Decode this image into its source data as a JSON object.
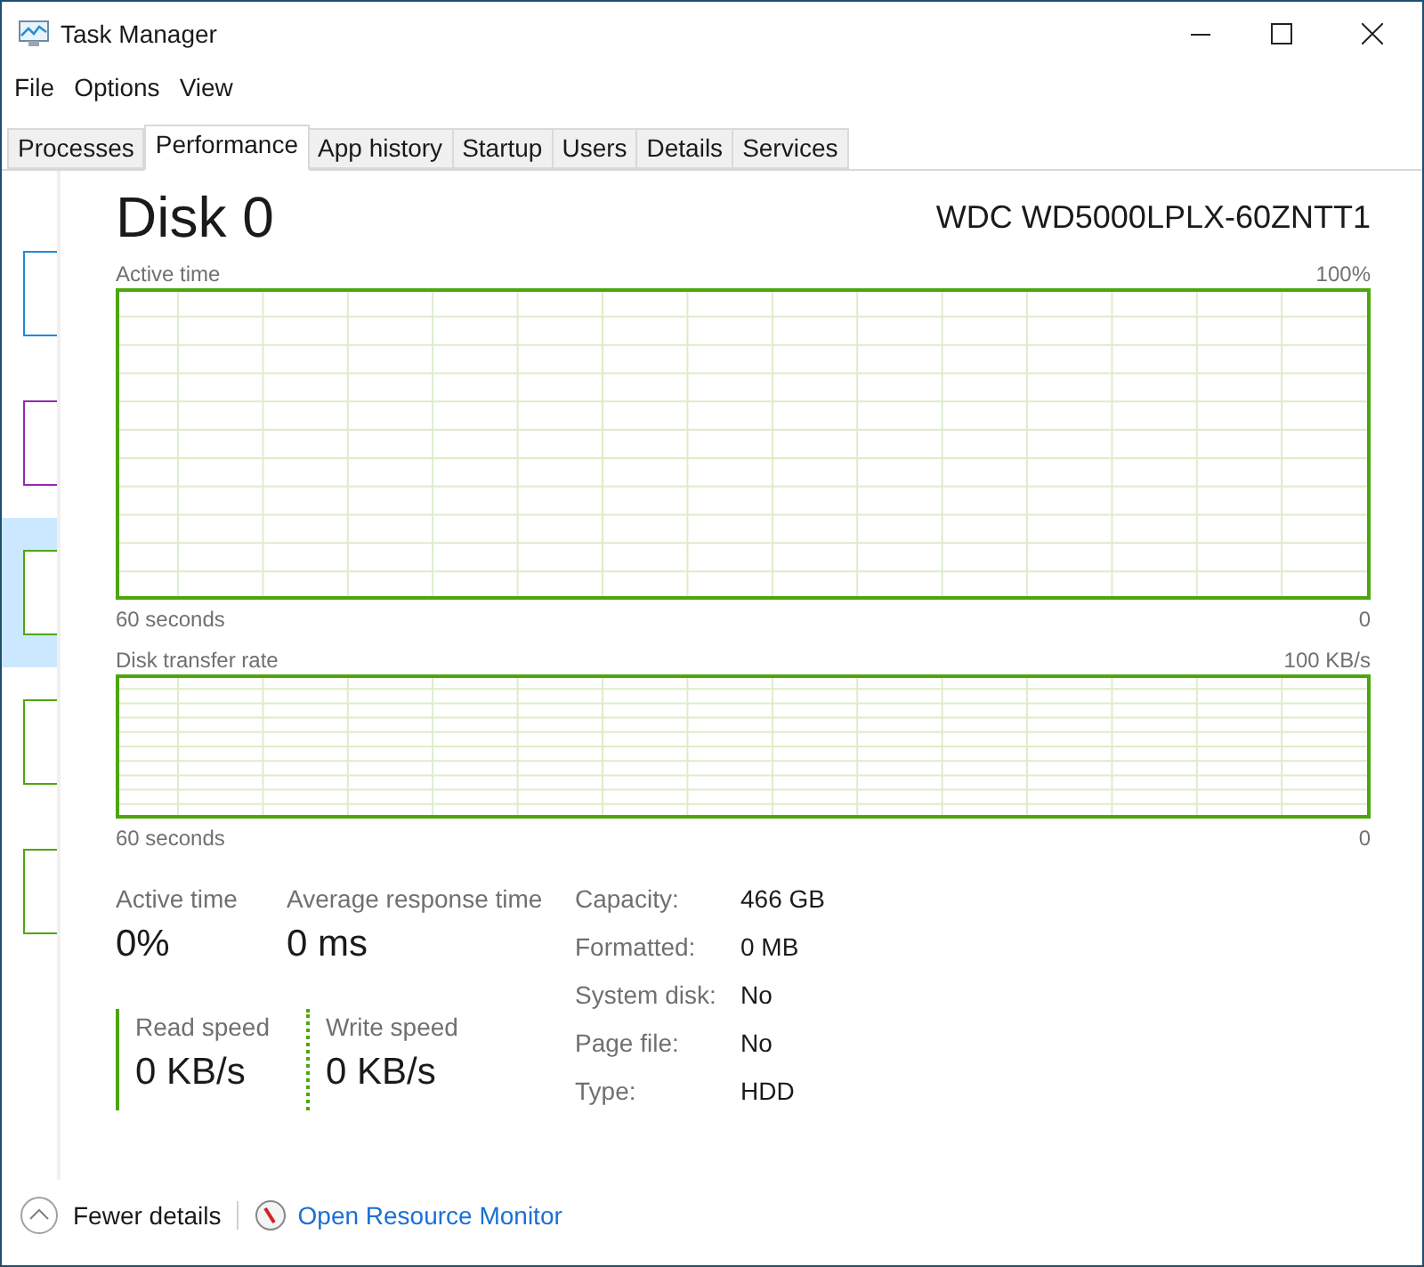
{
  "window": {
    "title": "Task Manager"
  },
  "menu": [
    "File",
    "Options",
    "View"
  ],
  "tabs": [
    {
      "label": "Processes",
      "selected": false
    },
    {
      "label": "Performance",
      "selected": true
    },
    {
      "label": "App history",
      "selected": false
    },
    {
      "label": "Startup",
      "selected": false
    },
    {
      "label": "Users",
      "selected": false
    },
    {
      "label": "Details",
      "selected": false
    },
    {
      "label": "Services",
      "selected": false
    }
  ],
  "sidebar": {
    "items": [
      {
        "color": "#1c8adb",
        "selected": false
      },
      {
        "color": "#9528b4",
        "selected": false
      },
      {
        "color": "#4da60c",
        "selected": true
      },
      {
        "color": "#4da60c",
        "selected": false
      },
      {
        "color": "#4da60c",
        "selected": false
      }
    ]
  },
  "header": {
    "title": "Disk 0",
    "model": "WDC WD5000LPLX-60ZNTT1"
  },
  "graphs": [
    {
      "label": "Active time",
      "max": "100%",
      "time": "60 seconds",
      "min": "0"
    },
    {
      "label": "Disk transfer rate",
      "max": "100 KB/s",
      "time": "60 seconds",
      "min": "0"
    }
  ],
  "stats": [
    {
      "label": "Active time",
      "value": "0%",
      "kind": "plain"
    },
    {
      "label": "Average response time",
      "value": "0 ms",
      "kind": "plain"
    },
    {
      "label": "Read speed",
      "value": "0 KB/s",
      "kind": "read"
    },
    {
      "label": "Write speed",
      "value": "0 KB/s",
      "kind": "write"
    }
  ],
  "properties": [
    {
      "label": "Capacity:",
      "value": "466 GB"
    },
    {
      "label": "Formatted:",
      "value": "0 MB"
    },
    {
      "label": "System disk:",
      "value": "No"
    },
    {
      "label": "Page file:",
      "value": "No"
    },
    {
      "label": "Type:",
      "value": "HDD"
    }
  ],
  "footer": {
    "fewer": "Fewer details",
    "monitor": "Open Resource Monitor"
  }
}
